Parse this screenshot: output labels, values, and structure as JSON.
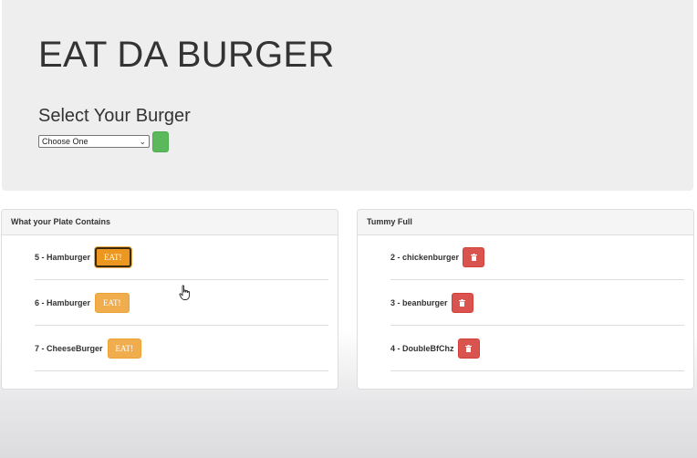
{
  "header": {
    "title": "EAT DA BURGER",
    "subtitle": "Select Your Burger",
    "select_value": "Choose One"
  },
  "plate": {
    "heading": "What your Plate Contains",
    "eat_label": "EAT!",
    "items": [
      {
        "label": "5 - Hamburger"
      },
      {
        "label": "6 - Hamburger"
      },
      {
        "label": "7 - CheeseBurger"
      }
    ]
  },
  "tummy": {
    "heading": "Tummy Full",
    "items": [
      {
        "label": "2 - chickenburger"
      },
      {
        "label": "3 - beanburger"
      },
      {
        "label": "4 - DoubleBfChz"
      }
    ]
  },
  "colors": {
    "eat_button": "#f0ad4e",
    "delete_button": "#d9534f",
    "submit_button": "#5cb85c"
  },
  "icons": {
    "delete": "trash-icon",
    "cursor": "hand-pointer-icon"
  }
}
